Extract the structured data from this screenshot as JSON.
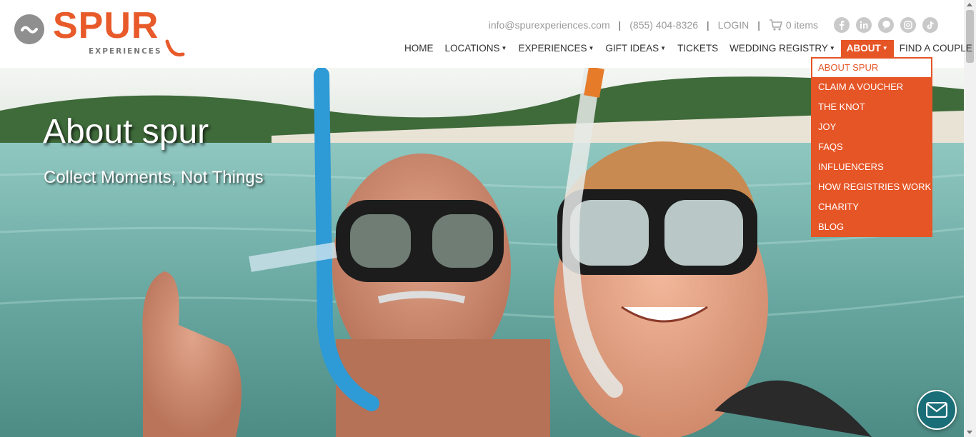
{
  "brand": {
    "name": "SPUR",
    "sub": "EXPERIENCES"
  },
  "topbar": {
    "email": "info@spurexperiences.com",
    "phone": "(855) 404-8326",
    "login": "LOGIN",
    "cart": "0 items",
    "social_icons": [
      "facebook-icon",
      "linkedin-icon",
      "pinterest-icon",
      "instagram-icon",
      "tiktok-icon"
    ]
  },
  "nav": {
    "items": [
      {
        "label": "HOME",
        "dropdown": false
      },
      {
        "label": "LOCATIONS",
        "dropdown": true
      },
      {
        "label": "EXPERIENCES",
        "dropdown": true
      },
      {
        "label": "GIFT IDEAS",
        "dropdown": true
      },
      {
        "label": "TICKETS",
        "dropdown": false
      },
      {
        "label": "WEDDING REGISTRY",
        "dropdown": true
      },
      {
        "label": "ABOUT",
        "dropdown": true,
        "active": true
      },
      {
        "label": "FIND A COUPLE",
        "dropdown": false
      }
    ]
  },
  "about_menu": {
    "items": [
      "ABOUT SPUR",
      "CLAIM A VOUCHER",
      "THE KNOT",
      "JOY",
      "FAQS",
      "INFLUENCERS",
      "HOW REGISTRIES WORK",
      "CHARITY",
      "BLOG"
    ],
    "selected": "ABOUT SPUR"
  },
  "hero": {
    "title": "About spur",
    "subtitle": "Collect Moments, Not Things"
  },
  "colors": {
    "accent": "#e65526",
    "chat": "#1a6e78",
    "muted_text": "#9a9a9a"
  }
}
